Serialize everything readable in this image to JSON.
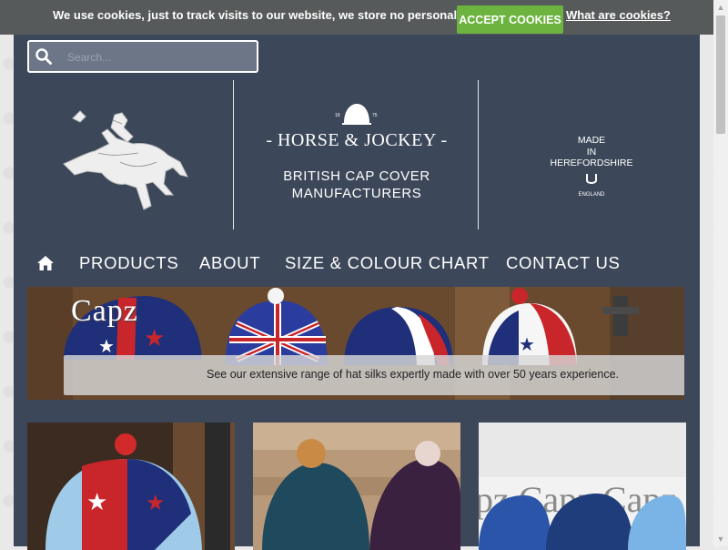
{
  "cookie_bar": {
    "message": "We use cookies, just to track visits to our website, we store no personal details.",
    "accept_label": "ACCEPT COOKIES",
    "info_link": "What are cookies?"
  },
  "search": {
    "placeholder": "Search..."
  },
  "header": {
    "brand_name": "- HORSE & JOCKEY -",
    "tagline_line1": "BRITISH CAP COVER",
    "tagline_line2": "MANUFACTURERS",
    "cap_year_left": "19",
    "cap_year_right": "75",
    "made_line1": "MADE",
    "made_line2": "IN",
    "made_line3": "HEREFORDSHIRE",
    "made_line4": "ENGLAND"
  },
  "nav": {
    "items": [
      {
        "label": "PRODUCTS"
      },
      {
        "label": "ABOUT"
      },
      {
        "label": "SIZE & COLOUR CHART"
      },
      {
        "label": "CONTACT US"
      }
    ]
  },
  "banner": {
    "title": "Capz",
    "text": "See our extensive range of hat silks expertly made with over 50 years experience."
  },
  "colors": {
    "panel": "#3c4859",
    "cookie_bar": "#575a5a",
    "accept_button": "#6cb33f"
  }
}
